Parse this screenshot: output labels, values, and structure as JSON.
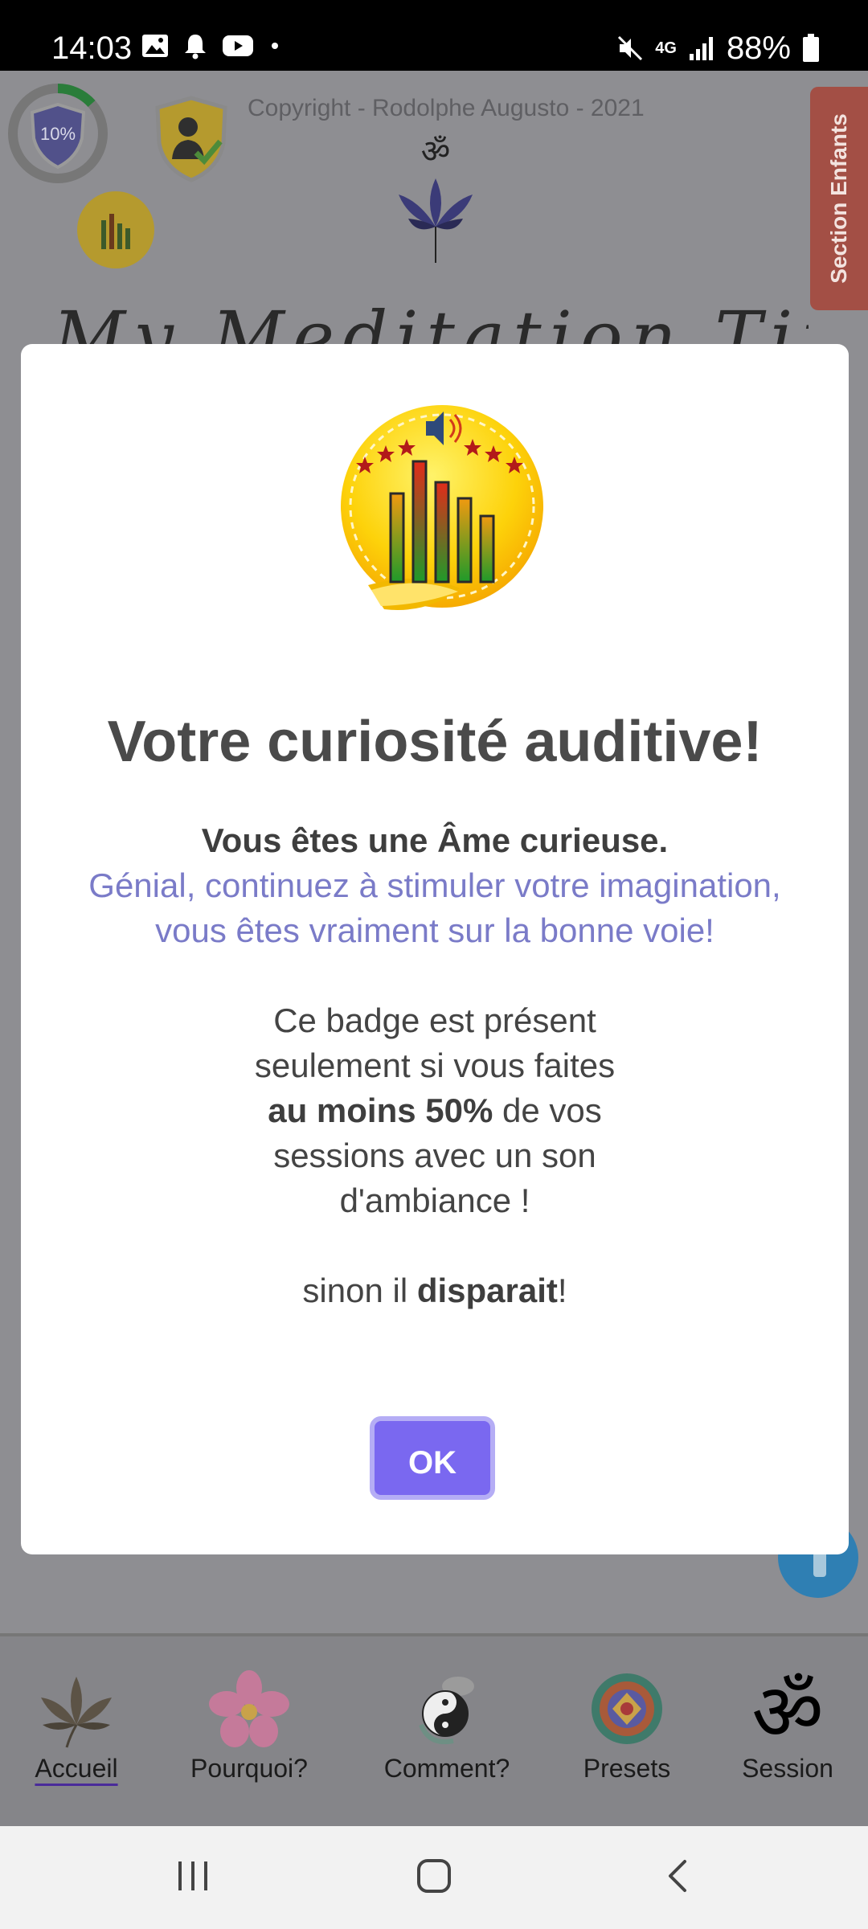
{
  "status_bar": {
    "time": "14:03",
    "network": "4G",
    "battery": "88%"
  },
  "background": {
    "progress_badge_label": "10%",
    "copyright": "Copyright - Rodolphe Augusto - 2021",
    "side_tab": "Section Enfants",
    "app_title": "My Meditation Time"
  },
  "modal": {
    "title": "Votre curiosité auditive!",
    "lead_bold": "Vous êtes une Âme curieuse.",
    "lead_purple": "Génial, continuez à stimuler votre imagination, vous êtes vraiment sur la bonne voie!",
    "p2_a": "Ce badge est présent",
    "p2_b": "seulement si vous faites",
    "p2_c_bold": "au moins 50%",
    "p2_c_rest": " de vos",
    "p2_d": "sessions avec un son",
    "p2_e": "d'ambiance !",
    "p3_pre": "sinon il ",
    "p3_bold": "disparait",
    "p3_post": "!",
    "ok_label": "OK"
  },
  "bottom_nav": {
    "items": [
      {
        "label": "Accueil",
        "icon": "lotus-icon"
      },
      {
        "label": "Pourquoi?",
        "icon": "flower-icon"
      },
      {
        "label": "Comment?",
        "icon": "yin-yang-icon"
      },
      {
        "label": "Presets",
        "icon": "mandala-icon"
      },
      {
        "label": "Session",
        "icon": "om-icon"
      }
    ]
  },
  "colors": {
    "accent": "#7a68f0",
    "purple_text": "#7a7bc8",
    "overlay": "#8e8e92"
  }
}
